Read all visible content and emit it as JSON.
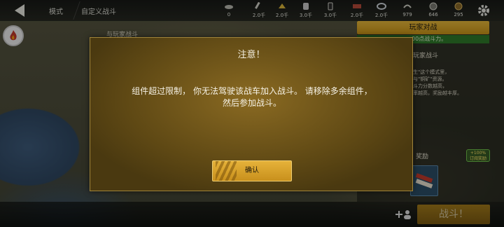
{
  "topbar": {
    "crumb_mode": "模式",
    "crumb_custom": "自定义战斗",
    "resources": [
      {
        "icon": "silver-icon",
        "value": "0"
      },
      {
        "icon": "wrench-icon",
        "value": "2.0千"
      },
      {
        "icon": "gold-icon",
        "value": "2.0千"
      },
      {
        "icon": "steel-icon",
        "value": "3.0千"
      },
      {
        "icon": "fuel-icon",
        "value": "3.0千"
      },
      {
        "icon": "ammo-icon",
        "value": "2.0千"
      },
      {
        "icon": "tire-icon",
        "value": "2.0千"
      },
      {
        "icon": "engine-icon",
        "value": "979"
      },
      {
        "icon": "coin-icon",
        "value": "646"
      },
      {
        "icon": "crown-icon",
        "value": "295"
      }
    ]
  },
  "background": {
    "faded_title": "与玩家战斗"
  },
  "right_panel": {
    "mode_button": "玩家对战",
    "green_line": "00点战斗力。",
    "title": "玩家战斗",
    "description_lines": [
      "生\"这个模式里，",
      "与\"铜矿\"资源。",
      "斗力分数越高，",
      "率越高，奖励越丰厚。"
    ],
    "reward_label": "奖励",
    "bonus_line1": "+100%",
    "bonus_line2": "订阅奖励"
  },
  "bottombar": {
    "battle_button": "战斗！"
  },
  "modal": {
    "title": "注意！",
    "message_line1": "组件超过限制， 你无法驾驶该战车加入战斗。 请移除多余组件，",
    "message_line2": "然后参加战斗。",
    "confirm_label": "确认"
  },
  "colors": {
    "accent_gold": "#e6b23a",
    "modal_bg": "#6e5418",
    "green": "#2f7a2a"
  }
}
